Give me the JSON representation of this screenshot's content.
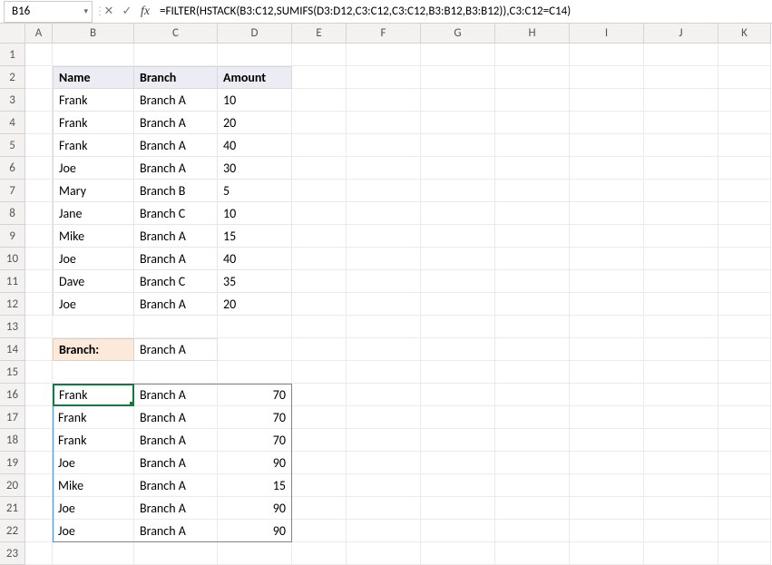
{
  "name_box": "B16",
  "formula": "=FILTER(HSTACK(B3:C12,SUMIFS(D3:D12,C3:C12,C3:C12,B3:B12,B3:B12)),C3:C12=C14)",
  "columns": [
    "A",
    "B",
    "C",
    "D",
    "E",
    "F",
    "G",
    "H",
    "I",
    "J",
    "K"
  ],
  "rows": [
    "1",
    "2",
    "3",
    "4",
    "5",
    "6",
    "7",
    "8",
    "9",
    "10",
    "11",
    "12",
    "13",
    "14",
    "15",
    "16",
    "17",
    "18",
    "19",
    "20",
    "21",
    "22",
    "23"
  ],
  "headers": {
    "name": "Name",
    "branch": "Branch",
    "amount": "Amount"
  },
  "data_table": [
    {
      "name": "Frank",
      "branch": "Branch A",
      "amount": "10"
    },
    {
      "name": "Frank",
      "branch": "Branch A",
      "amount": "20"
    },
    {
      "name": "Frank",
      "branch": "Branch A",
      "amount": "40"
    },
    {
      "name": "Joe",
      "branch": "Branch A",
      "amount": "30"
    },
    {
      "name": "Mary",
      "branch": "Branch B",
      "amount": "5"
    },
    {
      "name": "Jane",
      "branch": "Branch C",
      "amount": "10"
    },
    {
      "name": "Mike",
      "branch": "Branch A",
      "amount": "15"
    },
    {
      "name": "Joe",
      "branch": "Branch A",
      "amount": "40"
    },
    {
      "name": "Dave",
      "branch": "Branch C",
      "amount": "35"
    },
    {
      "name": "Joe",
      "branch": "Branch A",
      "amount": "20"
    }
  ],
  "filter_label": "Branch:",
  "filter_value": "Branch A",
  "result_table": [
    {
      "name": "Frank",
      "branch": "Branch A",
      "sum": "70"
    },
    {
      "name": "Frank",
      "branch": "Branch A",
      "sum": "70"
    },
    {
      "name": "Frank",
      "branch": "Branch A",
      "sum": "70"
    },
    {
      "name": "Joe",
      "branch": "Branch A",
      "sum": "90"
    },
    {
      "name": "Mike",
      "branch": "Branch A",
      "sum": "15"
    },
    {
      "name": "Joe",
      "branch": "Branch A",
      "sum": "90"
    },
    {
      "name": "Joe",
      "branch": "Branch A",
      "sum": "90"
    }
  ]
}
